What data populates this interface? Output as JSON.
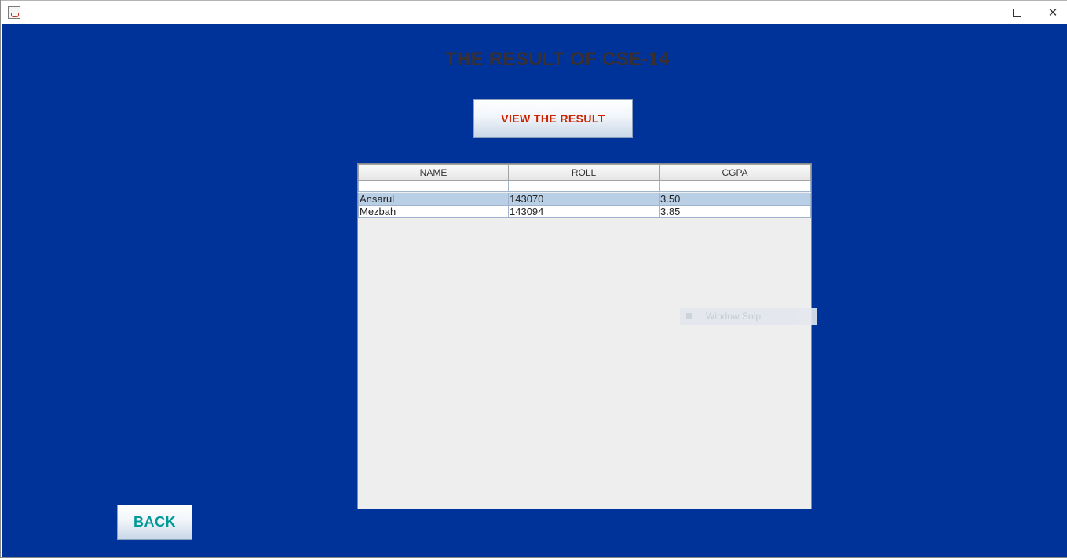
{
  "window": {
    "title": "",
    "icon": "java-cup-icon",
    "controls": {
      "minimize": "minimize-icon",
      "maximize": "maximize-icon",
      "close": "close-icon"
    }
  },
  "main": {
    "heading": "THE RESULT OF CSE-14",
    "view_button_label": "VIEW THE RESULT",
    "back_button_label": "BACK"
  },
  "table": {
    "columns": [
      "NAME",
      "ROLL",
      "CGPA"
    ],
    "rows": [
      {
        "name": "",
        "roll": "",
        "cgpa": ""
      },
      {
        "name": "Ansarul",
        "roll": "143070",
        "cgpa": "3.50",
        "selected": true
      },
      {
        "name": "Mezbah",
        "roll": "143094",
        "cgpa": "3.85"
      }
    ]
  },
  "overlay": {
    "label": "Window Snip"
  },
  "colors": {
    "background": "#003399",
    "heading": "#3a3030",
    "view_button_text": "#cc2200",
    "back_button_text": "#009999",
    "selected_row": "#b8cfe5"
  }
}
